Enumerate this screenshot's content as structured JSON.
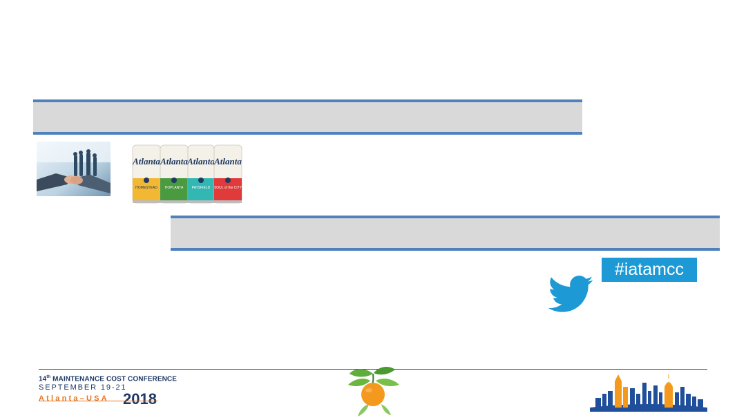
{
  "slide": {
    "band_top_text": "",
    "band_bottom_text": ""
  },
  "images": {
    "handshake": "handshake-photo",
    "cans": "atlanta-brewing-cans-photo"
  },
  "social": {
    "hashtag": "#iatamcc",
    "icon": "twitter-bird-icon",
    "color": "#1d9ad6"
  },
  "footer": {
    "conference_title_prefix": "14",
    "conference_title_sup": "th",
    "conference_title_rest": " MAINTENANCE COST CONFERENCE",
    "dates": "SEPTEMBER 19-21",
    "city": "Atlanta–USA",
    "year": "2018",
    "peach_logo": "peach-icon",
    "skyline_logo": "atlanta-skyline-icon"
  },
  "colors": {
    "band_fill": "#d9d9d9",
    "band_border": "#4f81bd",
    "navy": "#1f3864",
    "orange": "#e87722"
  }
}
